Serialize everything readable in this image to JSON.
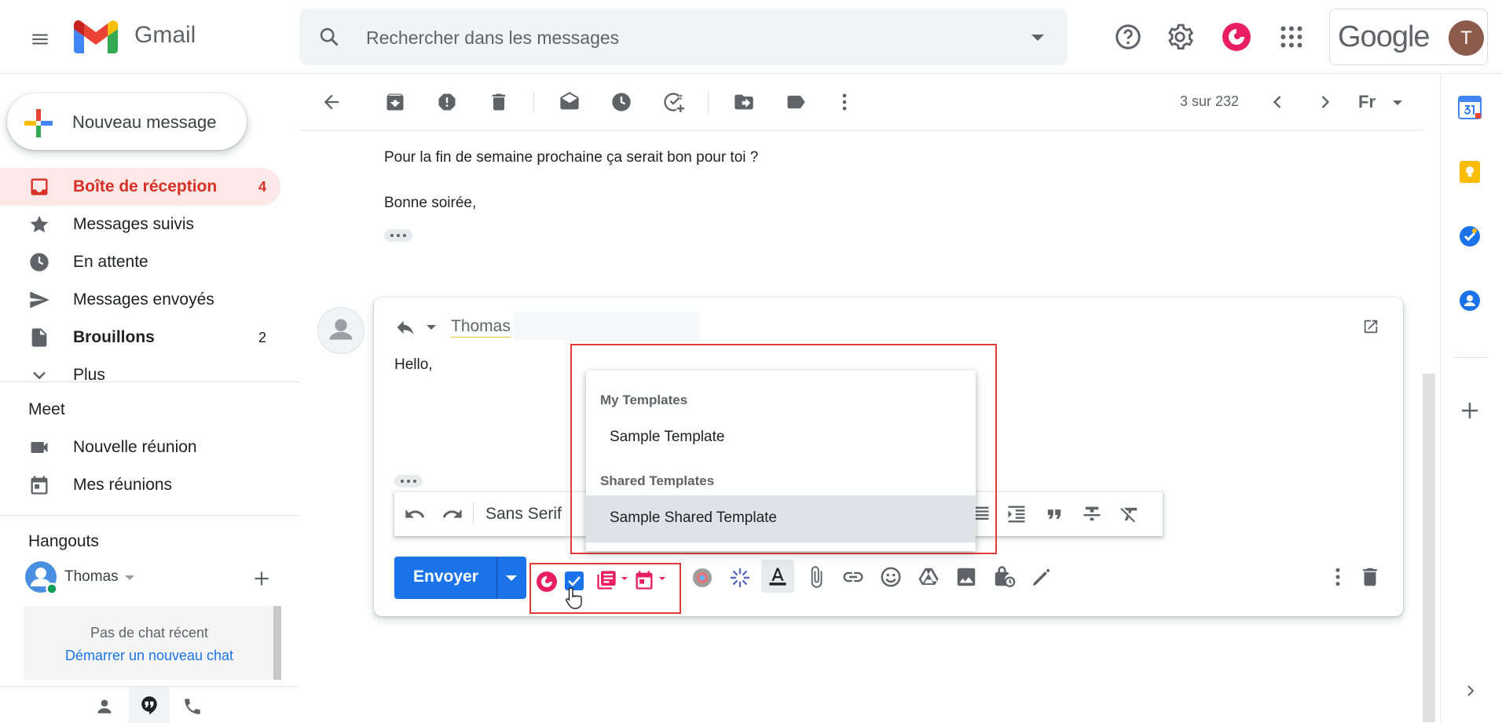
{
  "header": {
    "app_name": "Gmail",
    "search_placeholder": "Rechercher dans les messages",
    "brand": "Google",
    "avatar_initial": "T"
  },
  "sidebar": {
    "compose_label": "Nouveau message",
    "items": [
      {
        "label": "Boîte de réception",
        "count": "4",
        "icon": "inbox-icon"
      },
      {
        "label": "Messages suivis",
        "count": "",
        "icon": "star-icon"
      },
      {
        "label": "En attente",
        "count": "",
        "icon": "clock-icon"
      },
      {
        "label": "Messages envoyés",
        "count": "",
        "icon": "send-icon"
      },
      {
        "label": "Brouillons",
        "count": "2",
        "icon": "draft-icon"
      },
      {
        "label": "Plus",
        "count": "",
        "icon": "chevron-down-icon"
      }
    ],
    "meet": {
      "title": "Meet",
      "items": [
        {
          "label": "Nouvelle réunion",
          "icon": "video-icon"
        },
        {
          "label": "Mes réunions",
          "icon": "calendar-icon"
        }
      ]
    },
    "hangouts": {
      "title": "Hangouts",
      "user": "Thomas",
      "empty_text": "Pas de chat récent",
      "start_link": "Démarrer un nouveau chat"
    }
  },
  "toolbar": {
    "page_count": "3 sur 232",
    "lang_label": "Fr"
  },
  "message": {
    "line1": "Pour la fin de semaine prochaine ça serait bon pour toi ?",
    "line2": "Bonne soirée,"
  },
  "reply": {
    "recipient": "Thomas",
    "body": "Hello,",
    "font": "Sans Serif",
    "send_label": "Envoyer"
  },
  "template_menu": {
    "my_heading": "My Templates",
    "my_items": [
      "Sample Template"
    ],
    "shared_heading": "Shared Templates",
    "shared_items": [
      "Sample Shared Template"
    ]
  },
  "colors": {
    "accent_red": "#d93025",
    "send_blue": "#1a73e8",
    "highlight_box": "#e53935",
    "addon_pink": "#e91e63"
  }
}
